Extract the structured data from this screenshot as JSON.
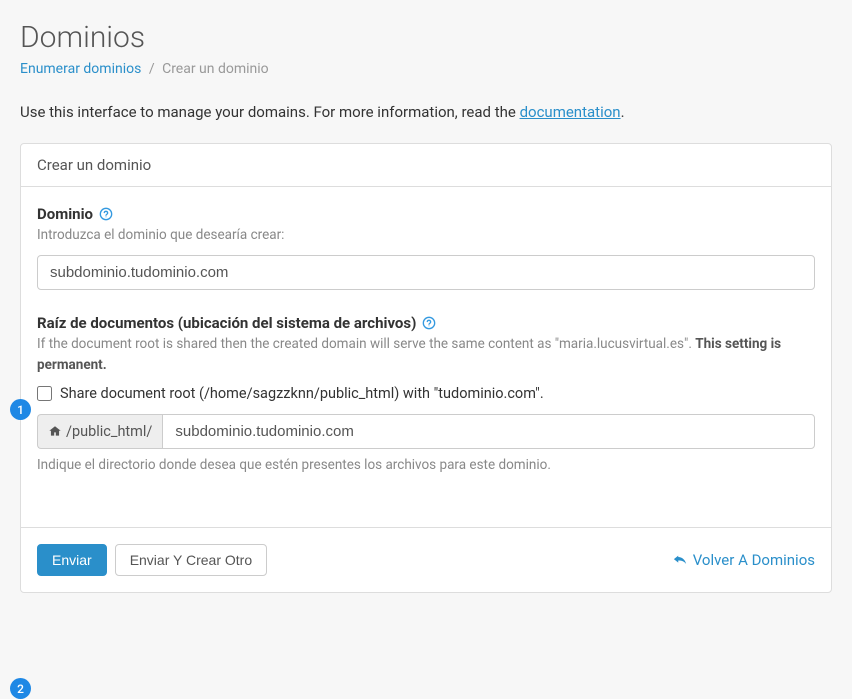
{
  "page": {
    "title": "Dominios",
    "breadcrumb": {
      "list_domains": "Enumerar dominios",
      "create_domain": "Crear un dominio"
    },
    "intro_pre": "Use this interface to manage your domains. For more information, read the ",
    "intro_link": "documentation",
    "intro_post": "."
  },
  "panel": {
    "header": "Crear un dominio"
  },
  "domain_field": {
    "label": "Dominio",
    "help": "Introduzca el dominio que desearía crear:",
    "value": "subdominio.tudominio.com"
  },
  "docroot_field": {
    "label": "Raíz de documentos (ubicación del sistema de archivos)",
    "help_pre": "If the document root is shared then the created domain will serve the same content as \"maria.lucusvirtual.es\". ",
    "help_strong": "This setting is permanent.",
    "share_checkbox": "Share document root (/home/sagzzknn/public_html) with \"tudominio.com\".",
    "addon_path": "/public_html/",
    "value": "subdominio.tudominio.com",
    "hint": "Indique el directorio donde desea que estén presentes los archivos para este dominio."
  },
  "footer": {
    "submit": "Enviar",
    "submit_another": "Enviar Y Crear Otro",
    "back": "Volver A Dominios"
  },
  "callouts": {
    "one": "1",
    "two": "2"
  }
}
